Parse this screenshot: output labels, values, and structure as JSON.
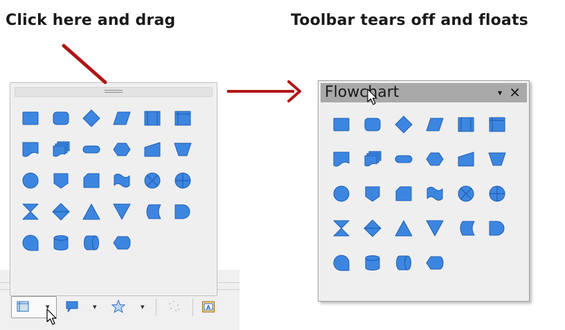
{
  "captions": {
    "left": "Click here and drag",
    "right": "Toolbar tears off and floats"
  },
  "floating_toolbar": {
    "title": "Flowchart",
    "menu_glyph": "▾",
    "close_glyph": "×"
  },
  "shapes": [
    "flowchart-process",
    "flowchart-alternate-process",
    "flowchart-decision",
    "flowchart-data",
    "flowchart-predefined-process",
    "flowchart-internal-storage",
    "flowchart-document",
    "flowchart-multidocument",
    "flowchart-terminator",
    "flowchart-preparation",
    "flowchart-manual-input",
    "flowchart-manual-operation",
    "flowchart-connector",
    "flowchart-off-page-connector",
    "flowchart-card",
    "flowchart-punched-tape",
    "flowchart-summing-junction",
    "flowchart-or",
    "flowchart-collate",
    "flowchart-sort",
    "flowchart-extract",
    "flowchart-merge",
    "flowchart-stored-data",
    "flowchart-delay",
    "flowchart-sequential-access",
    "flowchart-magnetic-disc",
    "flowchart-direct-access-storage",
    "flowchart-display"
  ],
  "docked_toolbar": {
    "buttons": [
      "flowchart-icon",
      "callout-icon",
      "star-icon",
      "points-icon",
      "text-frame-icon"
    ],
    "dropdown_glyph": "▾"
  },
  "colors": {
    "arrow": "#b01515",
    "shape_fill": "#3d86e0",
    "titlebar": "#a9a9a9"
  }
}
